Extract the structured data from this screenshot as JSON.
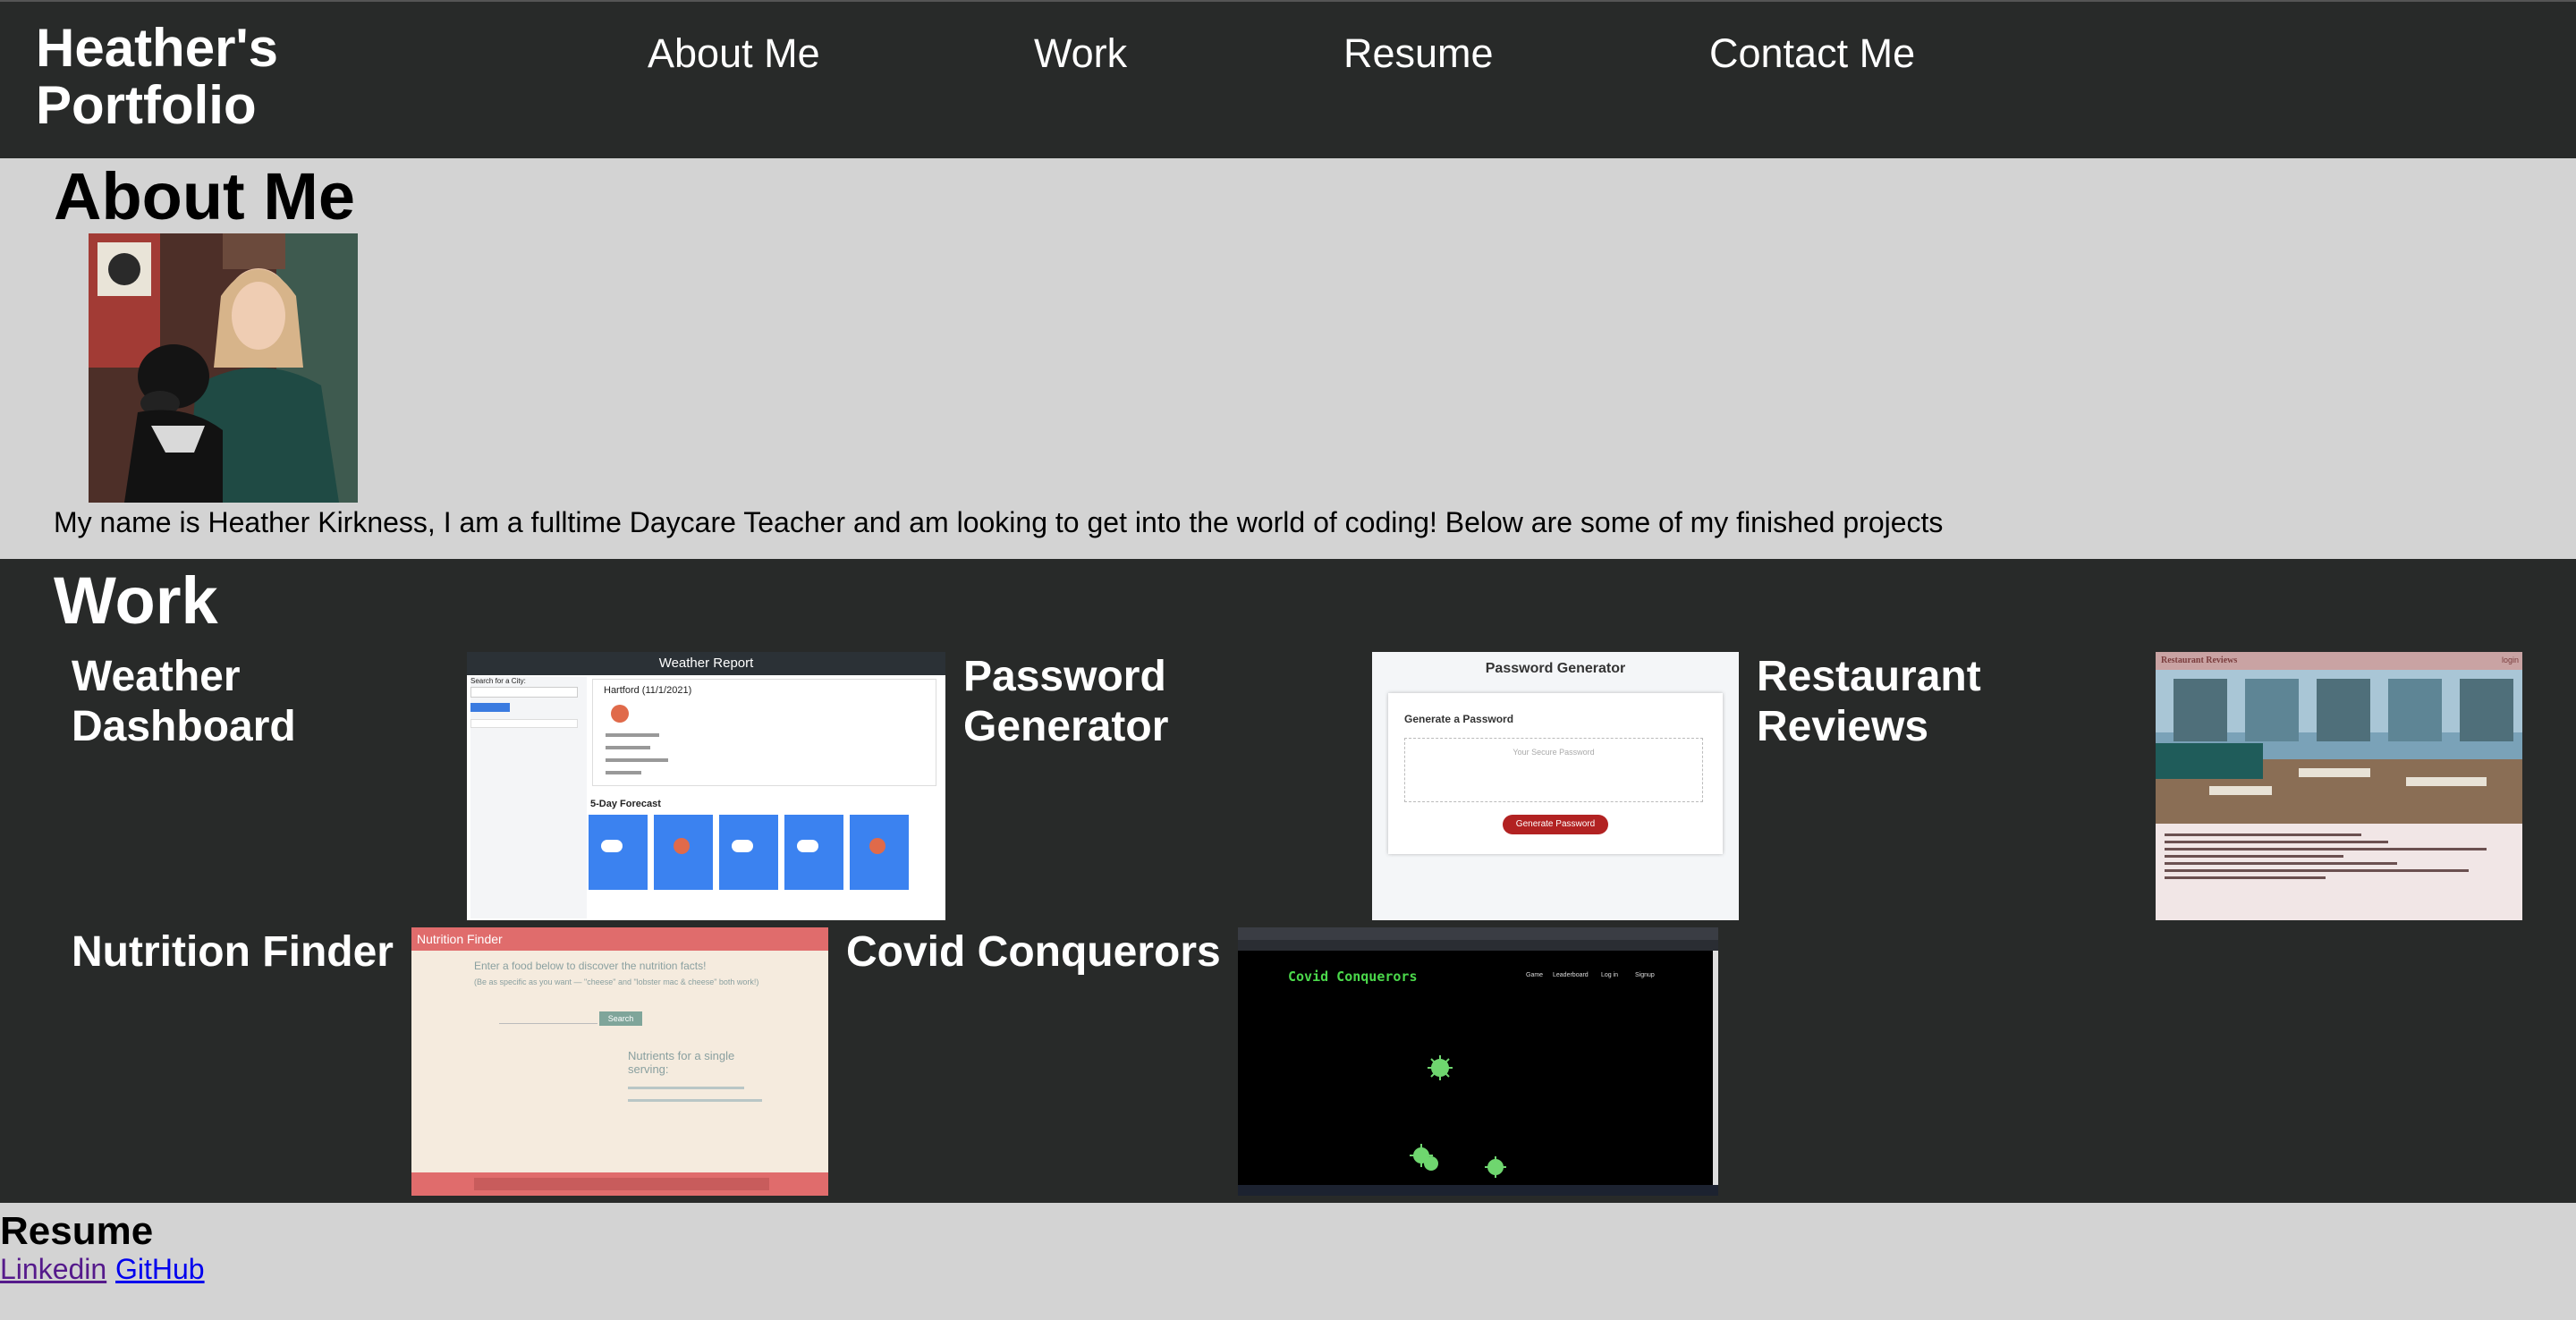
{
  "header": {
    "brand": "Heather's Portfolio",
    "nav": [
      "About Me",
      "Work",
      "Resume",
      "Contact Me"
    ]
  },
  "about": {
    "heading": "About Me",
    "photo_alt": "photo of Heather with a dog",
    "bio": "My name is Heather Kirkness, I am a fulltime Daycare Teacher and am looking to get into the world of coding! Below are some of my finished projects"
  },
  "work": {
    "heading": "Work",
    "projects": [
      {
        "title": "Weather Dashboard",
        "thumb": {
          "header": "Weather Report",
          "search_label": "Search for a City:",
          "city": "Hartford (11/1/2021)",
          "forecast_label": "5-Day Forecast"
        }
      },
      {
        "title": "Password Generator",
        "thumb": {
          "header": "Password Generator",
          "subheader": "Generate a Password",
          "placeholder": "Your Secure Password",
          "button": "Generate Password"
        }
      },
      {
        "title": "Restaurant Reviews",
        "thumb": {
          "header": "Restaurant Reviews",
          "login": "login"
        }
      },
      {
        "title": "Nutrition Finder",
        "thumb": {
          "header": "Nutrition Finder",
          "prompt": "Enter a food below to discover the nutrition facts!",
          "hint": "(Be as specific as you want — \"cheese\" and \"lobster mac & cheese\" both work!)",
          "button": "Search",
          "result_title": "Nutrients for a single serving:"
        }
      },
      {
        "title": "Covid Conquerors",
        "thumb": {
          "header": "Covid Conquerors",
          "nav": [
            "Game",
            "Leaderboard",
            "Log in",
            "Signup"
          ]
        }
      }
    ]
  },
  "resume": {
    "heading": "Resume",
    "links": [
      "Linkedin",
      "GitHub"
    ]
  },
  "colors": {
    "header_bg": "#282a29",
    "section_light": "#d3d3d3",
    "link_visited": "#551a8b",
    "link": "#0000ee"
  }
}
